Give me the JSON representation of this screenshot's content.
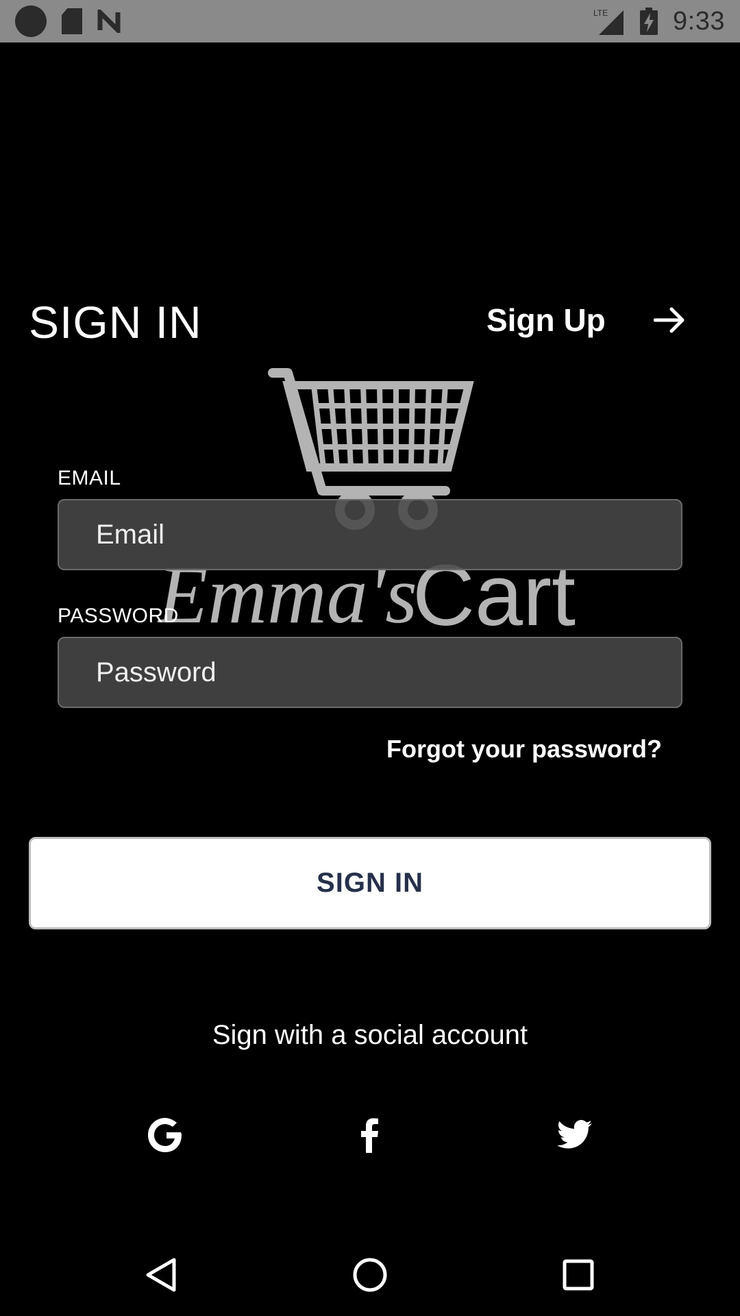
{
  "status_bar": {
    "time": "9:33",
    "network": "LTE",
    "icons": [
      "notification-dot-icon",
      "sd-card-icon",
      "n-logo-icon",
      "lte-signal-icon",
      "battery-charging-icon"
    ]
  },
  "header": {
    "title": "SIGN IN",
    "signup_label": "Sign Up",
    "signup_icon": "arrow-right-icon"
  },
  "logo": {
    "text_script": "Emma's",
    "text_bold": "Cart",
    "icon": "shopping-cart-icon"
  },
  "form": {
    "email_label": "EMAIL",
    "email_placeholder": "Email",
    "email_value": "",
    "password_label": "PASSWORD",
    "password_placeholder": "Password",
    "password_value": "",
    "forgot_label": "Forgot your password?"
  },
  "signin_button": {
    "label": "SIGN IN"
  },
  "social": {
    "caption": "Sign with a social account",
    "providers": [
      "google-icon",
      "facebook-icon",
      "twitter-icon"
    ]
  },
  "nav": {
    "icons": [
      "back-icon",
      "home-icon",
      "recents-icon"
    ]
  },
  "colors": {
    "background": "#000000",
    "status_bar": "#8a8a8a",
    "field_bg": "#484848",
    "button_text": "#27304a",
    "logo": "#b3b3b3"
  }
}
